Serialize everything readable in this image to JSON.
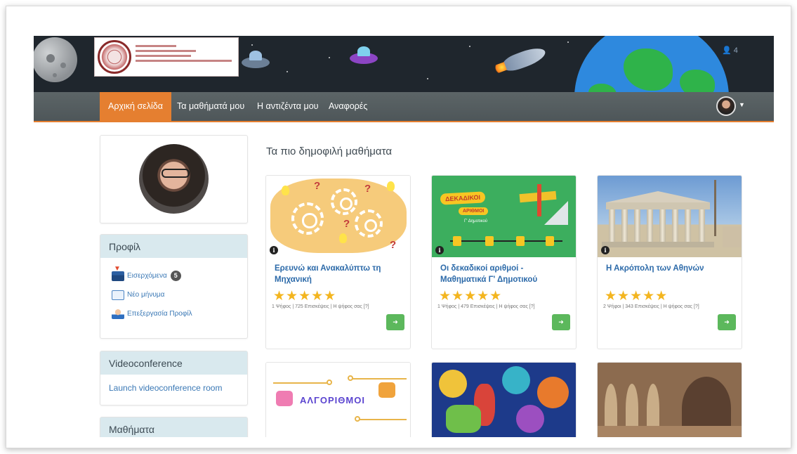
{
  "banner": {
    "user_count": "4"
  },
  "navbar": {
    "items": [
      {
        "label": "Αρχική σελίδα",
        "active": true
      },
      {
        "label": "Τα μαθήματά μου",
        "active": false
      },
      {
        "label": "Η αντιζέντα μου",
        "active": false
      },
      {
        "label": "Αναφορές",
        "active": false
      }
    ]
  },
  "sidebar": {
    "profile": {
      "header": "Προφίλ",
      "links": [
        {
          "label": "Εισερχόμενα",
          "icon": "inbox-icon",
          "badge": "5"
        },
        {
          "label": "Νέο μήνυμα",
          "icon": "mail-icon"
        },
        {
          "label": "Επεξεργασία Προφίλ",
          "icon": "user-edit-icon"
        }
      ]
    },
    "videoconference": {
      "header": "Videoconference",
      "link": "Launch videoconference room"
    },
    "courses": {
      "header": "Μαθήματα"
    }
  },
  "main": {
    "section_title": "Τα πιο δημοφιλή μαθήματα",
    "courses": [
      {
        "title": "Ερευνώ και Ανακαλύπτω τη Μηχανική",
        "stars": "★★★★★",
        "meta": "1 Ψήφος | 725 Επισκέψεις | Η ψήφος σας [?]"
      },
      {
        "title": "Οι δεκαδικοί αριθμοί - Μαθηματικά Γ' Δημοτικού",
        "stars": "★★★★★",
        "meta": "1 Ψήφος | 479 Επισκέψεις | Η ψήφος σας [?]",
        "image_text": {
          "label1": "ΔΕΚΑΔΙΚΟΙ",
          "label2": "ΑΡΙΘΜΟΙ",
          "sub": "Γ' Δημοτικού"
        }
      },
      {
        "title": "Η Ακρόπολη των Αθηνών",
        "stars": "★★★★★",
        "meta": "2 Ψήφοι | 343 Επισκέψεις | Η ψήφος σας [?]"
      },
      {
        "image_text": {
          "label": "ΑΛΓΟΡΙΘΜΟΙ"
        }
      },
      {},
      {}
    ]
  },
  "colors": {
    "accent": "#e57f30",
    "navbar": "#525a5d",
    "link": "#2c6aa9",
    "star": "#f3b51f",
    "button": "#5cb85c",
    "panel_header": "#d9e9ee"
  }
}
